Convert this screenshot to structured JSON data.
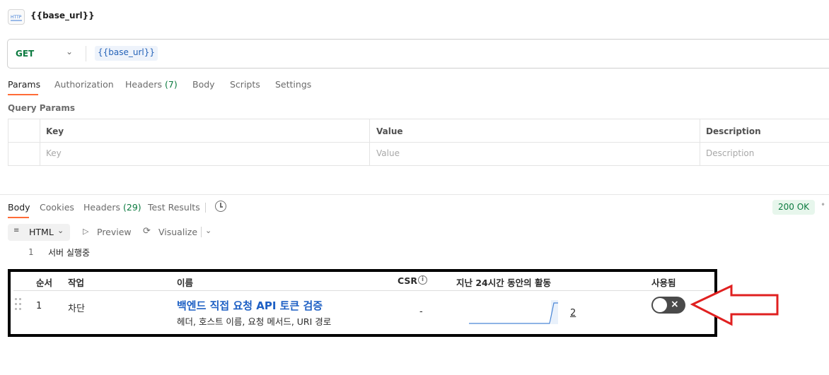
{
  "header": {
    "icon_label": "HTTP",
    "title": "{{base_url}}"
  },
  "request": {
    "method": "GET",
    "url": "{{base_url}}"
  },
  "request_tabs": {
    "params": "Params",
    "authorization": "Authorization",
    "headers": "Headers",
    "headers_count": "(7)",
    "body": "Body",
    "scripts": "Scripts",
    "settings": "Settings"
  },
  "query_params": {
    "label": "Query Params",
    "columns": [
      "Key",
      "Value",
      "Description"
    ],
    "placeholders": [
      "Key",
      "Value",
      "Description"
    ]
  },
  "response_tabs": {
    "body": "Body",
    "cookies": "Cookies",
    "headers": "Headers",
    "headers_count": "(29)",
    "test_results": "Test Results",
    "history_icon": "history-icon"
  },
  "status": {
    "text": "200 OK",
    "color": "#0b7a3f"
  },
  "response_toolbar": {
    "format": "HTML",
    "preview": "Preview",
    "visualize": "Visualize"
  },
  "response_body": {
    "line_number": "1",
    "text": "서버 실행중"
  },
  "rules_table": {
    "headers": [
      "순서",
      "작업",
      "이름",
      "CSR",
      "지난 24시간 동안의 활동",
      "사용됨"
    ],
    "row": {
      "order": "1",
      "action": "차단",
      "name": "백엔드 직접 요청 API 토큰 검증",
      "description": "헤더, 호스트 이름, 요청 메서드, URI 경로",
      "csr": "-",
      "activity_count": "2",
      "enabled": false
    },
    "highlight_border_color": "#000000",
    "arrow_color": "#e02020"
  }
}
